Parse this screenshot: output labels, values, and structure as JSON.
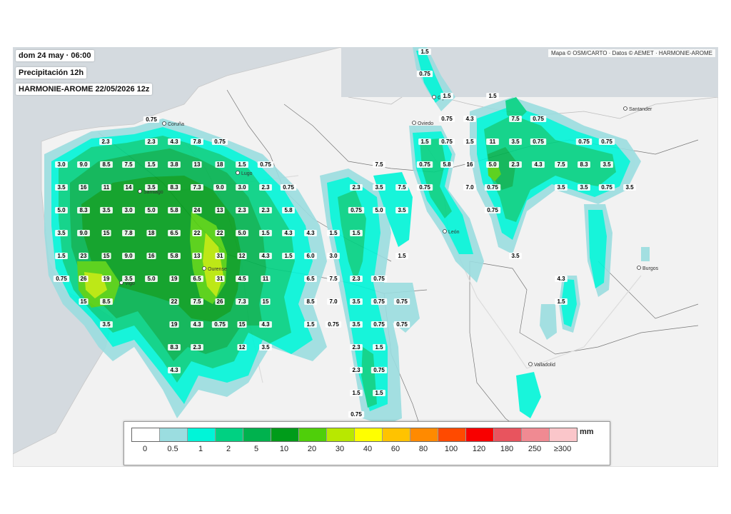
{
  "header": {
    "date_time": "dom 24 may · 06:00",
    "variable": "Precipitación 12h",
    "model_run": "HARMONIE-AROME 22/05/2026 12z"
  },
  "attribution": "Mapa © OSM/CARTO · Datos © AEMET · HARMONIE-AROME",
  "cities": [
    {
      "name": "Coruña"
    },
    {
      "name": "Lugo"
    },
    {
      "name": "Santiago"
    },
    {
      "name": "Ourense"
    },
    {
      "name": "Vigo"
    },
    {
      "name": "Gijón"
    },
    {
      "name": "Oviedo"
    },
    {
      "name": "Santander"
    },
    {
      "name": "León"
    },
    {
      "name": "Burgos"
    },
    {
      "name": "Valladolid"
    }
  ],
  "precip_labels": [
    "0.75",
    "2.3",
    "2.3",
    "4.3",
    "7.8",
    "0.75",
    "3.0",
    "9.0",
    "8.5",
    "7.5",
    "1.5",
    "3.8",
    "13",
    "18",
    "1.5",
    "0.75",
    "3.5",
    "16",
    "11",
    "14",
    "3.5",
    "8.3",
    "7.3",
    "9.0",
    "3.0",
    "2.3",
    "0.75",
    "5.0",
    "8.3",
    "3.5",
    "3.0",
    "5.0",
    "5.8",
    "24",
    "13",
    "2.3",
    "2.3",
    "5.8",
    "3.5",
    "9.0",
    "15",
    "7.8",
    "18",
    "6.5",
    "22",
    "22",
    "5.0",
    "1.5",
    "4.3",
    "4.3",
    "1.5",
    "1.5",
    "1.5",
    "23",
    "15",
    "9.0",
    "16",
    "5.8",
    "13",
    "31",
    "12",
    "4.3",
    "1.5",
    "6.0",
    "3.0",
    "0.75",
    "26",
    "19",
    "3.5",
    "5.0",
    "19",
    "6.5",
    "31",
    "4.5",
    "11",
    "6.5",
    "7.5",
    "2.3",
    "0.75",
    "15",
    "8.5",
    "22",
    "7.5",
    "26",
    "7.3",
    "15",
    "8.5",
    "7.0",
    "3.5",
    "0.75",
    "0.75",
    "3.5",
    "19",
    "4.3",
    "0.75",
    "15",
    "4.3",
    "1.5",
    "0.75",
    "3.5",
    "0.75",
    "0.75",
    "8.3",
    "2.3",
    "12",
    "3.5",
    "2.3",
    "1.5",
    "4.3",
    "2.3",
    "0.75",
    "1.5",
    "1.5",
    "0.75",
    "1.5",
    "0.75",
    "1.5",
    "1.5",
    "0.75",
    "4.3",
    "7.5",
    "0.75",
    "1.5",
    "0.75",
    "1.5",
    "2.3",
    "11",
    "3.5",
    "0.75",
    "0.75",
    "0.75",
    "7.5",
    "0.75",
    "5.8",
    "16",
    "5.0",
    "2.3",
    "4.3",
    "7.5",
    "8.3",
    "3.5",
    "2.3",
    "3.5",
    "7.5",
    "0.75",
    "7.0",
    "0.75",
    "3.5",
    "3.5",
    "0.75",
    "3.5",
    "0.75",
    "5.0",
    "3.5",
    "0.75",
    "1.5",
    "3.5",
    "4.3",
    "1.5"
  ],
  "legend": {
    "unit": "mm",
    "ticks": [
      "0",
      "0.5",
      "1",
      "2",
      "5",
      "10",
      "20",
      "30",
      "40",
      "60",
      "80",
      "100",
      "120",
      "180",
      "250",
      "≥300"
    ],
    "colors": [
      "#ffffff",
      "#9bdde0",
      "#00f5d8",
      "#00d182",
      "#00b24e",
      "#009c1a",
      "#4fcf0a",
      "#b8e800",
      "#ffff00",
      "#ffc300",
      "#ff8a00",
      "#ff4a00",
      "#f80000",
      "#e8545e",
      "#f08a92",
      "#fac6ca"
    ]
  }
}
